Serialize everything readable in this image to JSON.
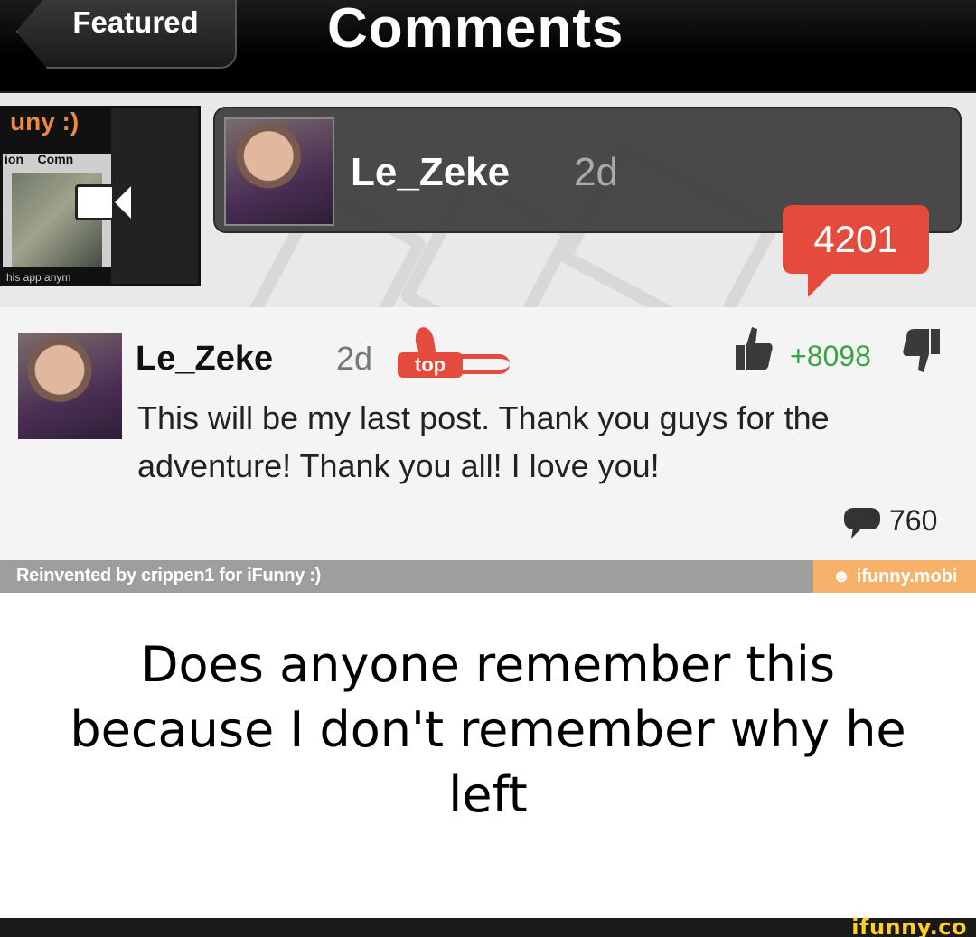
{
  "nav": {
    "back_label": "Featured",
    "title": "Comments"
  },
  "post": {
    "username": "Le_Zeke",
    "time": "2d",
    "comment_count": "4201"
  },
  "comment": {
    "username": "Le_Zeke",
    "time": "2d",
    "badge": "top",
    "score": "+8098",
    "text": "This will be my last post. Thank you guys for the adventure! Thank you all! I love you!",
    "reply_count": "760"
  },
  "credit": {
    "left": "Reinvented by crippen1 for iFunny :)",
    "right": "ifunny.mobi"
  },
  "caption": "Does anyone remember this because I don't remember why he left",
  "watermark": "ifunny.co",
  "colors": {
    "accent_red": "#e54b3c",
    "like_green": "#3aa34a",
    "credit_orange": "#f6b26b"
  },
  "icons": [
    "back-chevron",
    "video-camera-icon",
    "thumbs-up-icon",
    "thumbs-down-icon",
    "speech-bubble-icon",
    "smiley-icon"
  ]
}
